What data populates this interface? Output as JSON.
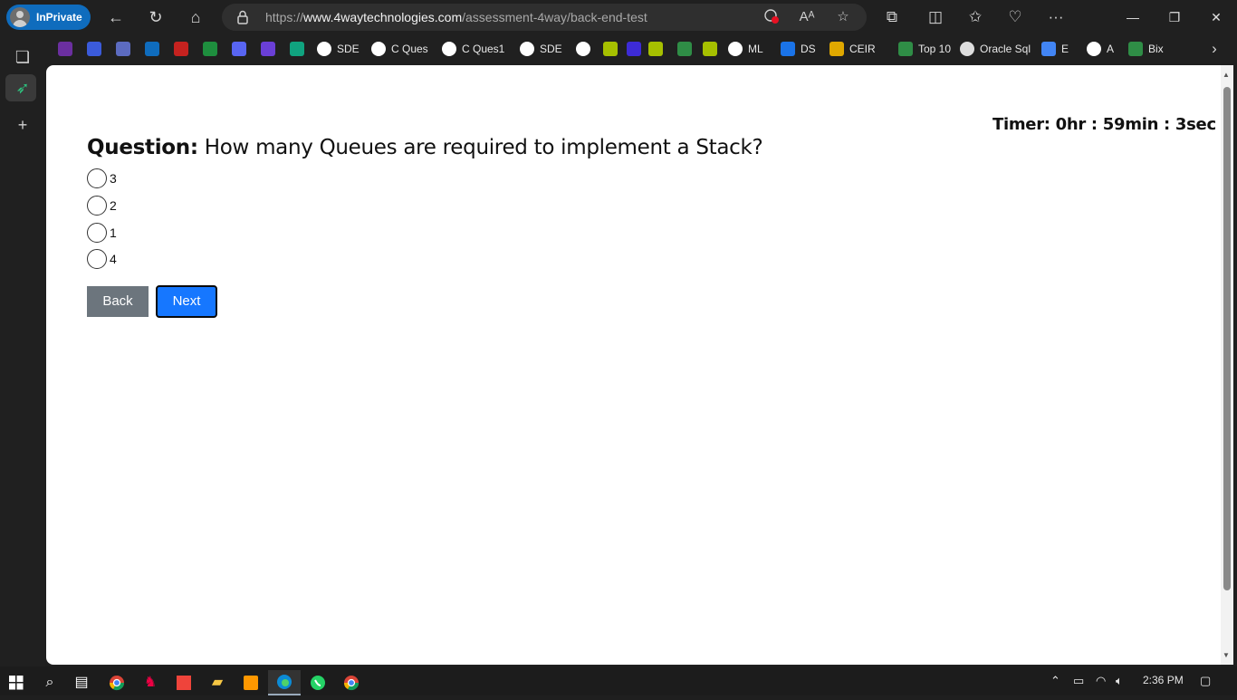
{
  "browser": {
    "profile_label": "InPrivate",
    "url_prefix": "https://",
    "url_domain": "www.4waytechnologies.com",
    "url_path": "/assessment-4way/back-end-test",
    "window_controls": {
      "minimize": "—",
      "restore": "❐",
      "close": "✕"
    }
  },
  "favorites": [
    {
      "label": "",
      "icon": "purple-app-icon",
      "color": "#6b2fa0"
    },
    {
      "label": "",
      "icon": "blue-round-icon",
      "color": "#3b5bdb"
    },
    {
      "label": "",
      "icon": "to-icon",
      "color": "#5c6bc0"
    },
    {
      "label": "",
      "icon": "outlook-icon",
      "color": "#0f6cbd"
    },
    {
      "label": "",
      "icon": "gmail-icon",
      "color": "#c5221f"
    },
    {
      "label": "",
      "icon": "sheets-plus-icon",
      "color": "#1e8e3e"
    },
    {
      "label": "",
      "icon": "swirl-icon",
      "color": "#5865f2"
    },
    {
      "label": "",
      "icon": "y-icon",
      "color": "#6a3fd6"
    },
    {
      "label": "",
      "icon": "chatgpt-icon",
      "color": "#10a37f"
    },
    {
      "label": "SDE",
      "icon": "github-icon",
      "color": "#ffffff"
    },
    {
      "label": "C Ques",
      "icon": "github-icon",
      "color": "#ffffff"
    },
    {
      "label": "C Ques1",
      "icon": "github-icon",
      "color": "#ffffff"
    },
    {
      "label": "SDE",
      "icon": "google-icon",
      "color": "#ffffff"
    },
    {
      "label": "",
      "icon": "google-icon",
      "color": "#ffffff"
    },
    {
      "label": "",
      "icon": "leetcode-icon",
      "color": "#a6c000"
    },
    {
      "label": "",
      "icon": "u-icon",
      "color": "#3d2bd6"
    },
    {
      "label": "",
      "icon": "leetcode-icon",
      "color": "#a6c000"
    },
    {
      "label": "",
      "icon": "gfg-icon",
      "color": "#2f8d46"
    },
    {
      "label": "",
      "icon": "leetcode-icon",
      "color": "#a6c000"
    },
    {
      "label": "ML",
      "icon": "google-icon",
      "color": "#ffffff"
    },
    {
      "label": "DS",
      "icon": "k-icon",
      "color": "#1a73e8"
    },
    {
      "label": "CEIR",
      "icon": "ceir-icon",
      "color": "#e0a800"
    },
    {
      "label": "Top 10",
      "icon": "gfg-icon",
      "color": "#2f8d46"
    },
    {
      "label": "Oracle Sql",
      "icon": "page-icon",
      "color": "#dddddd"
    },
    {
      "label": "E",
      "icon": "g-icon",
      "color": "#4285f4"
    },
    {
      "label": "A",
      "icon": "google-icon",
      "color": "#ffffff"
    },
    {
      "label": "Bix",
      "icon": "bix-icon",
      "color": "#2f8d46"
    }
  ],
  "page": {
    "timer": "Timer: 0hr : 59min : 3sec",
    "question_prefix": "Question:",
    "question_text": " How many Queues are required to implement a Stack?",
    "options": [
      "3",
      "2",
      "1",
      "4"
    ],
    "back_label": "Back",
    "next_label": "Next"
  },
  "taskbar": {
    "time": "2:36 PM"
  }
}
